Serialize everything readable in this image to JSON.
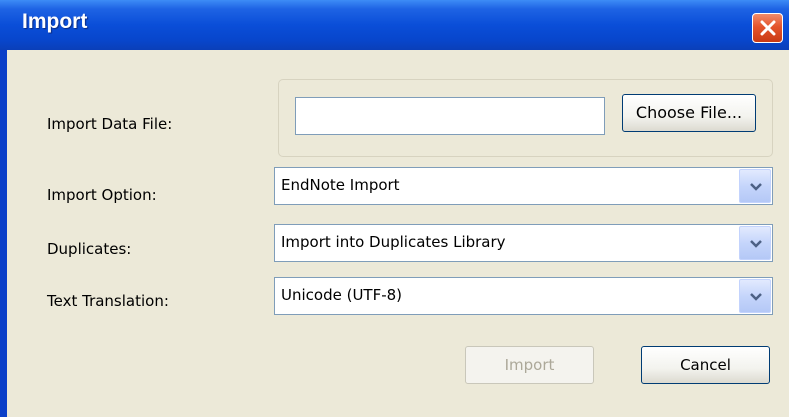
{
  "window": {
    "title": "Import"
  },
  "form": {
    "import_data_file": {
      "label": "Import Data File:",
      "value": "",
      "choose_button": "Choose File..."
    },
    "import_option": {
      "label": "Import Option:",
      "selected": "EndNote Import"
    },
    "duplicates": {
      "label": "Duplicates:",
      "selected": "Import into Duplicates Library"
    },
    "text_translation": {
      "label": "Text Translation:",
      "selected": "Unicode (UTF-8)"
    }
  },
  "buttons": {
    "import_label": "Import",
    "import_enabled": false,
    "cancel_label": "Cancel"
  },
  "colors": {
    "titlebar": "#0a4ed8",
    "close_button": "#e4542c",
    "dialog_background": "#ece9d8",
    "disabled_text": "#aca899"
  }
}
